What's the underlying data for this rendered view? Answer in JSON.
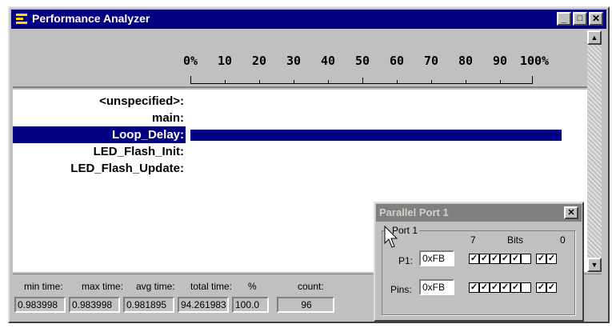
{
  "window": {
    "title": "Performance Analyzer",
    "buttons": {
      "minimize": "_",
      "maximize": "□",
      "close": "✕"
    }
  },
  "scale": {
    "ticks": [
      "0%",
      "10",
      "20",
      "30",
      "40",
      "50",
      "60",
      "70",
      "80",
      "90",
      "100%"
    ]
  },
  "functions": [
    {
      "name": "<unspecified>:",
      "percent": 0,
      "selected": false
    },
    {
      "name": "main:",
      "percent": 0,
      "selected": false
    },
    {
      "name": "Loop_Delay:",
      "percent": 100.0,
      "selected": true
    },
    {
      "name": "LED_Flash_Init:",
      "percent": 0,
      "selected": false
    },
    {
      "name": "LED_Flash_Update:",
      "percent": 0,
      "selected": false
    }
  ],
  "stats": {
    "min_label": "min time:",
    "min_value": "0.983998",
    "max_label": "max time:",
    "max_value": "0.983998",
    "avg_label": "avg time:",
    "avg_value": "0.981895",
    "total_label": "total time:",
    "total_value": "94.261983",
    "pct_label": "%",
    "pct_value": "100.0",
    "count_label": "count:",
    "count_value": "96"
  },
  "parallel_port": {
    "title": "Parallel Port 1",
    "close": "✕",
    "group_label": "Port 1",
    "bit_high": "7",
    "bits_label": "Bits",
    "bit_low": "0",
    "p1_label": "P1:",
    "p1_value": "0xFB",
    "pins_label": "Pins:",
    "pins_value": "0xFB",
    "p1_bits": [
      1,
      1,
      1,
      1,
      1,
      0,
      1,
      1
    ],
    "pins_bits": [
      1,
      1,
      1,
      1,
      1,
      0,
      1,
      1
    ],
    "check_glyph": "✓"
  },
  "icons": {
    "app": "bars-icon",
    "cursor": "arrow-cursor-icon"
  },
  "colors": {
    "selection": "#000080",
    "titlebar_active": "#000080",
    "titlebar_inactive": "#808080",
    "face": "#c0c0c0"
  }
}
